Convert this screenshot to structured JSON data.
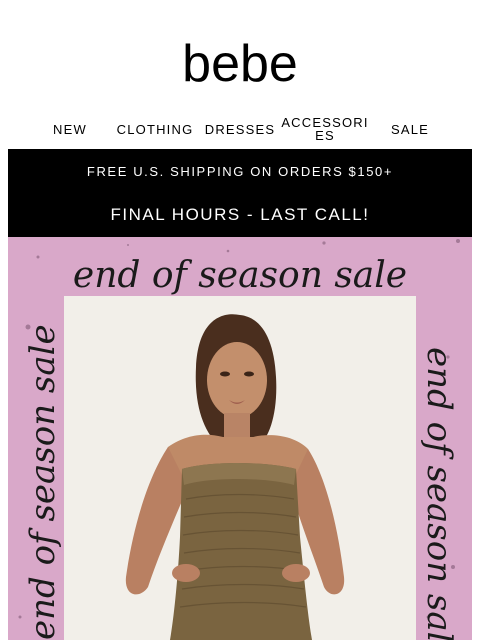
{
  "brand": {
    "logo": "bebe"
  },
  "nav": {
    "items": [
      {
        "label": "NEW"
      },
      {
        "label": "CLOTHING"
      },
      {
        "label": "DRESSES"
      },
      {
        "label": "ACCESSORIES"
      },
      {
        "label": "SALE"
      }
    ]
  },
  "promo": {
    "shipping": "FREE U.S. SHIPPING ON ORDERS $150+",
    "final_call": "FINAL HOURS - LAST CALL!"
  },
  "hero": {
    "headline": "end of season sale",
    "left_text": "end of season sale",
    "right_text": "end of season sale"
  },
  "colors": {
    "promo_bg": "#000000",
    "hero_bg": "#d9a8c9",
    "hero_frame": "#f2efe9",
    "dress": "#7a6440"
  }
}
